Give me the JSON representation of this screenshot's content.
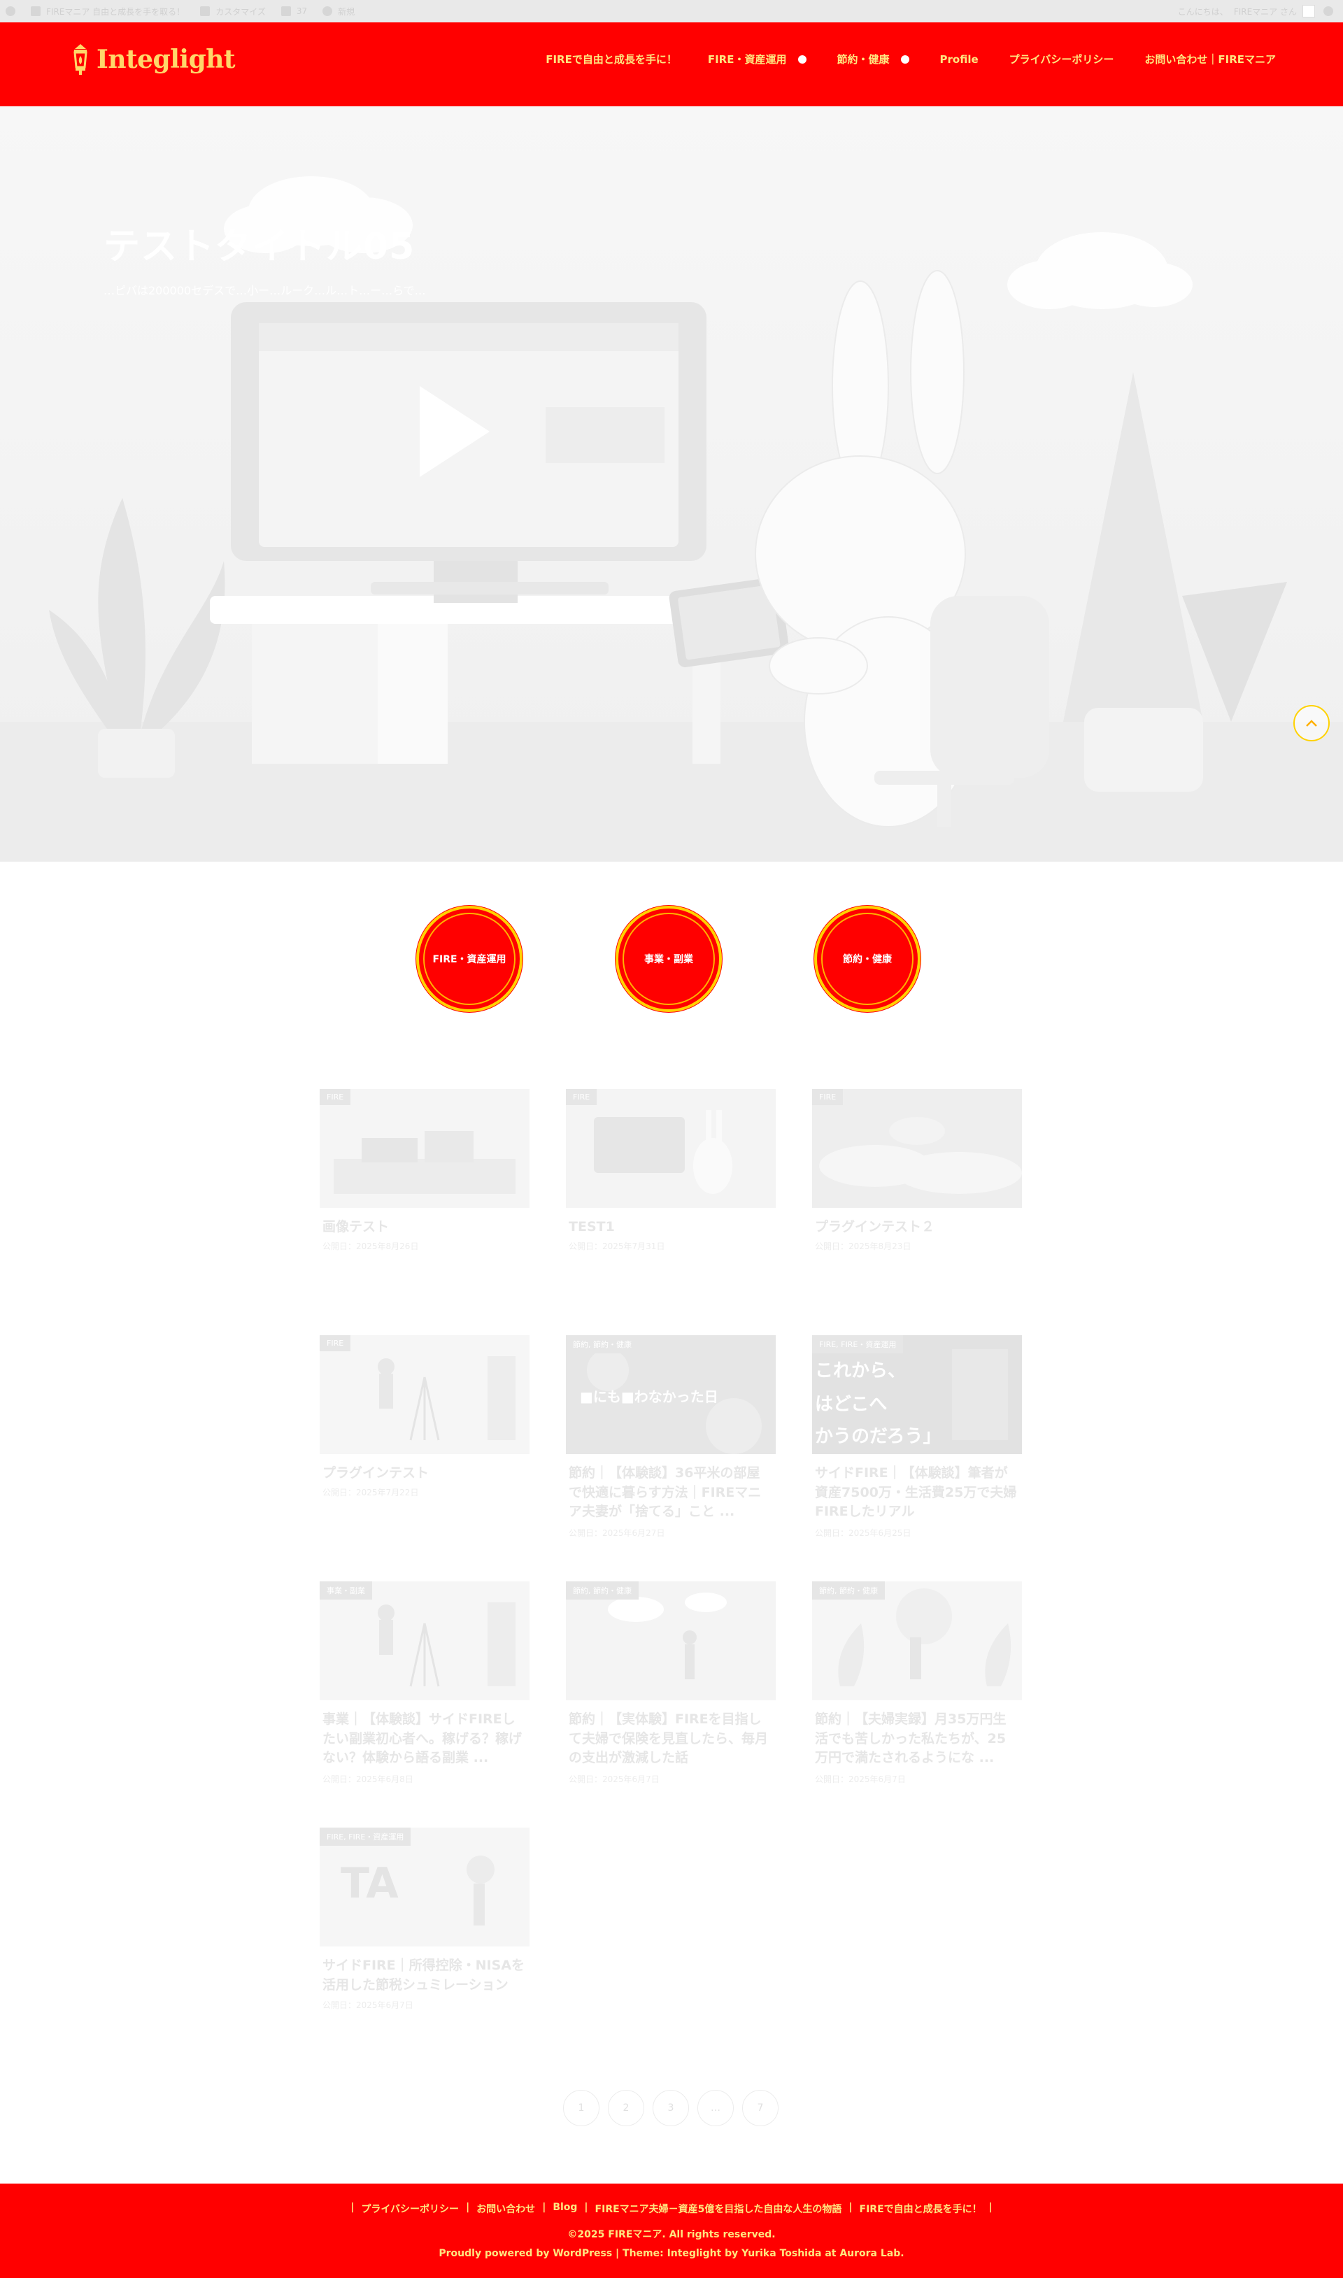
{
  "adminbar": {
    "site_name": "FIREマニア 自由と成長を手を取る！",
    "customize": "カスタマイズ",
    "comments": "37",
    "new": "新規",
    "howdy": "こんにちは、",
    "user": "FIREマニア さん"
  },
  "header": {
    "logo": "Integlight",
    "nav": [
      {
        "label": "FIREで自由と成長を手に！",
        "has_children": false
      },
      {
        "label": "FIRE・資産運用",
        "has_children": true
      },
      {
        "label": "節約・健康",
        "has_children": true
      },
      {
        "label": "Profile",
        "has_children": false
      },
      {
        "label": "プライバシーポリシー",
        "has_children": false
      },
      {
        "label": "お問い合わせ｜FIREマニア",
        "has_children": false
      }
    ]
  },
  "hero": {
    "title": "テストタイトル05",
    "subtitle": "…ピバは200000セデスで…小ー…ルーク…ル…ト…ー…らで…"
  },
  "categories": [
    "FIRE・資産運用",
    "事業・副業",
    "節約・健康"
  ],
  "posts": [
    {
      "label": "FIRE",
      "title": "画像テスト",
      "date": "公開日：2025年8月26日"
    },
    {
      "label": "FIRE",
      "title": "TEST1",
      "date": "公開日：2025年7月31日"
    },
    {
      "label": "FIRE",
      "title": "プラグインテスト２",
      "date": "公開日：2025年8月23日"
    },
    {
      "label": "FIRE",
      "title": "プラグインテスト",
      "date": "公開日：2025年7月22日"
    },
    {
      "label": "節約, 節約・健康",
      "title": "節約｜【体験談】36平米の部屋で快適に暮らす方法｜FIREマニア夫妻が「捨てる」こと ...",
      "date": "公開日：2025年6月27日"
    },
    {
      "label": "FIRE, FIRE・資産運用",
      "title": "サイドFIRE｜【体験談】筆者が資産7500万・生活費25万で夫婦FIREしたリアル",
      "date": "公開日：2025年6月25日"
    },
    {
      "label": "事業・副業",
      "title": "事業｜【体験談】サイドFIREしたい副業初心者へ。稼げる？稼げない？体験から語る副業 ...",
      "date": "公開日：2025年6月8日"
    },
    {
      "label": "節約, 節約・健康",
      "title": "節約｜【実体験】FIREを目指して夫婦で保険を見直したら、毎月の支出が激減した話",
      "date": "公開日：2025年6月7日"
    },
    {
      "label": "節約, 節約・健康",
      "title": "節約｜【夫婦実録】月35万円生活でも苦しかった私たちが、25万円で満たされるようにな ...",
      "date": "公開日：2025年6月7日"
    },
    {
      "label": "FIRE, FIRE・資産運用",
      "title": "サイドFIRE｜所得控除・NISAを活用した節税シュミレーション",
      "date": "公開日：2025年6月7日"
    }
  ],
  "thumb_texts": {
    "post5": "■にも■わなかった日",
    "post6_line1": "これから、",
    "post6_line2": "はどこへ",
    "post6_line3": "かうのだろう」"
  },
  "pagination": [
    "1",
    "2",
    "3",
    "…",
    "7"
  ],
  "footer": {
    "links": [
      "プライバシーポリシー",
      "お問い合わせ",
      "Blog",
      "FIREマニア夫婦－資産5億を目指した自由な人生の物語",
      "FIREで自由と成長を手に！"
    ],
    "separator": "|",
    "copyright": "©2025 FIREマニア. All rights reserved.",
    "powered": "Proudly powered by WordPress | Theme: Integlight by Yurika Toshida at Aurora Lab."
  },
  "colors": {
    "brand": "#ff0000",
    "accent": "#ffd200",
    "nav_text": "#ffe680"
  },
  "icons": [
    "wordpress-icon",
    "home-icon",
    "brush-icon",
    "comment-icon",
    "plus-icon",
    "search-icon",
    "chevron-up-icon",
    "lantern-icon"
  ]
}
